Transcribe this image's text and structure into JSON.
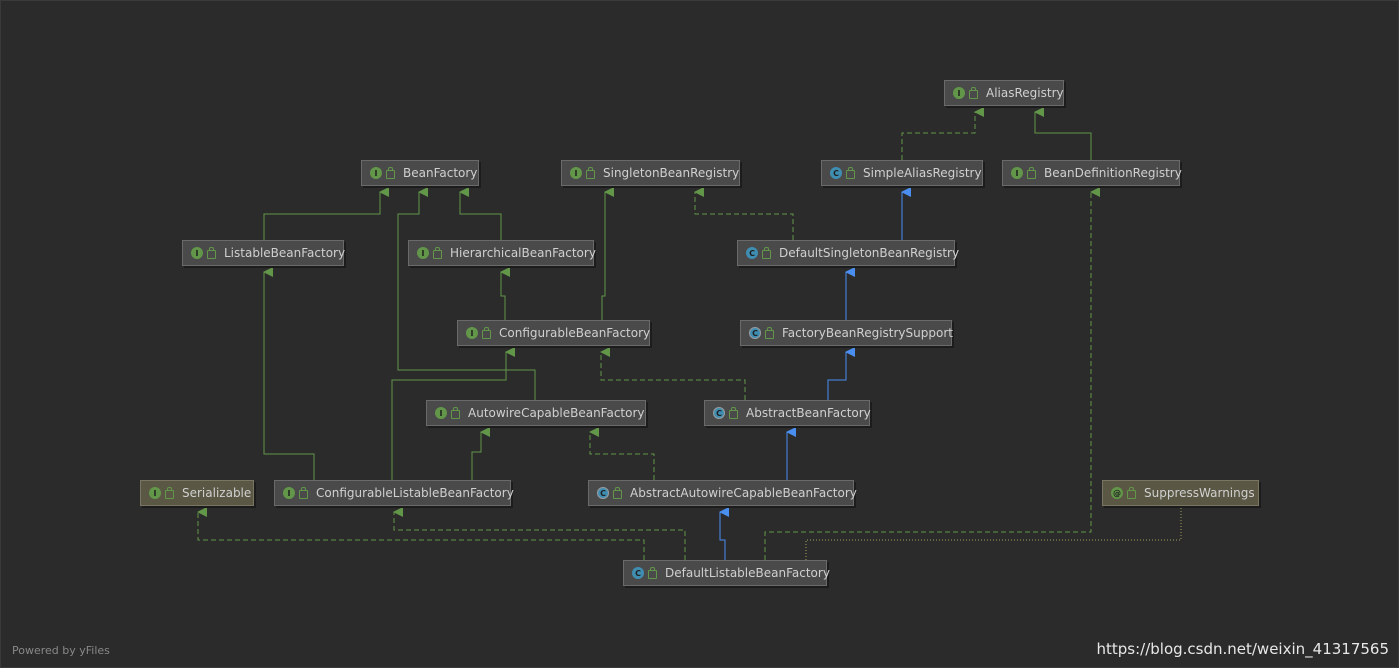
{
  "diagram": {
    "nodes": {
      "alias_registry": {
        "label": "AliasRegistry",
        "kind": "I"
      },
      "bean_factory": {
        "label": "BeanFactory",
        "kind": "I"
      },
      "singleton_bean_registry": {
        "label": "SingletonBeanRegistry",
        "kind": "I"
      },
      "simple_alias_registry": {
        "label": "SimpleAliasRegistry",
        "kind": "C"
      },
      "bean_definition_registry": {
        "label": "BeanDefinitionRegistry",
        "kind": "I"
      },
      "listable_bean_factory": {
        "label": "ListableBeanFactory",
        "kind": "I"
      },
      "hierarchical_bean_factory": {
        "label": "HierarchicalBeanFactory",
        "kind": "I"
      },
      "default_singleton_bean_registry": {
        "label": "DefaultSingletonBeanRegistry",
        "kind": "C"
      },
      "configurable_bean_factory": {
        "label": "ConfigurableBeanFactory",
        "kind": "I"
      },
      "factory_bean_registry_support": {
        "label": "FactoryBeanRegistrySupport",
        "kind": "C"
      },
      "autowire_capable_bean_factory": {
        "label": "AutowireCapableBeanFactory",
        "kind": "I"
      },
      "abstract_bean_factory": {
        "label": "AbstractBeanFactory",
        "kind": "C"
      },
      "serializable": {
        "label": "Serializable",
        "kind": "I"
      },
      "configurable_listable_bean_factory": {
        "label": "ConfigurableListableBeanFactory",
        "kind": "I"
      },
      "abstract_autowire_capable_bean_factory": {
        "label": "AbstractAutowireCapableBeanFactory",
        "kind": "C"
      },
      "suppress_warnings": {
        "label": "SuppressWarnings",
        "kind": "@"
      },
      "default_listable_bean_factory": {
        "label": "DefaultListableBeanFactory",
        "kind": "C"
      }
    }
  },
  "footer": {
    "powered_by": "Powered by yFiles",
    "watermark": "https://blog.csdn.net/weixin_41317565"
  },
  "colors": {
    "background": "#2b2b2b",
    "interface_edge": "#62974a",
    "class_edge": "#4a8ef0",
    "annotation_edge": "#a0a060"
  }
}
